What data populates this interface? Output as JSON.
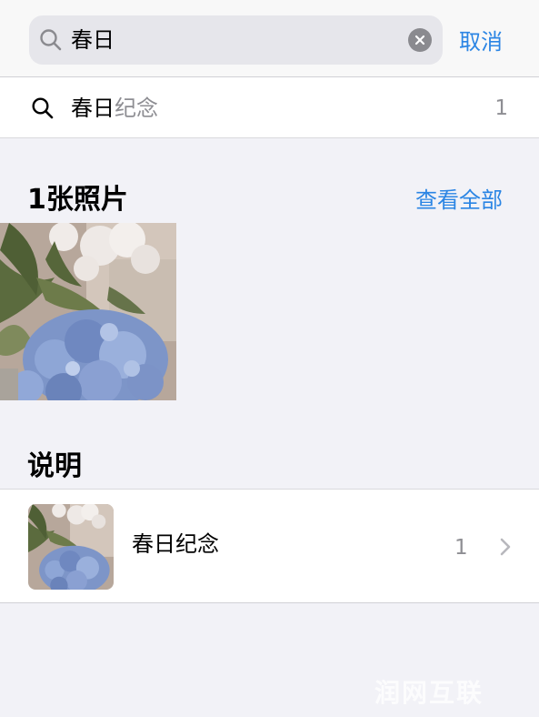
{
  "search": {
    "query": "春日",
    "cancel_label": "取消"
  },
  "suggestion": {
    "match_text": "春日",
    "rest_text": "纪念",
    "count": "1"
  },
  "photos_section": {
    "title": "1张照片",
    "see_all_label": "查看全部"
  },
  "descriptions_section": {
    "title": "说明",
    "items": [
      {
        "label": "春日纪念",
        "count": "1"
      }
    ]
  },
  "watermark": "润网互联",
  "colors": {
    "accent": "#2b85e4",
    "background": "#f2f2f7",
    "secondary_text": "#8e8e93"
  }
}
